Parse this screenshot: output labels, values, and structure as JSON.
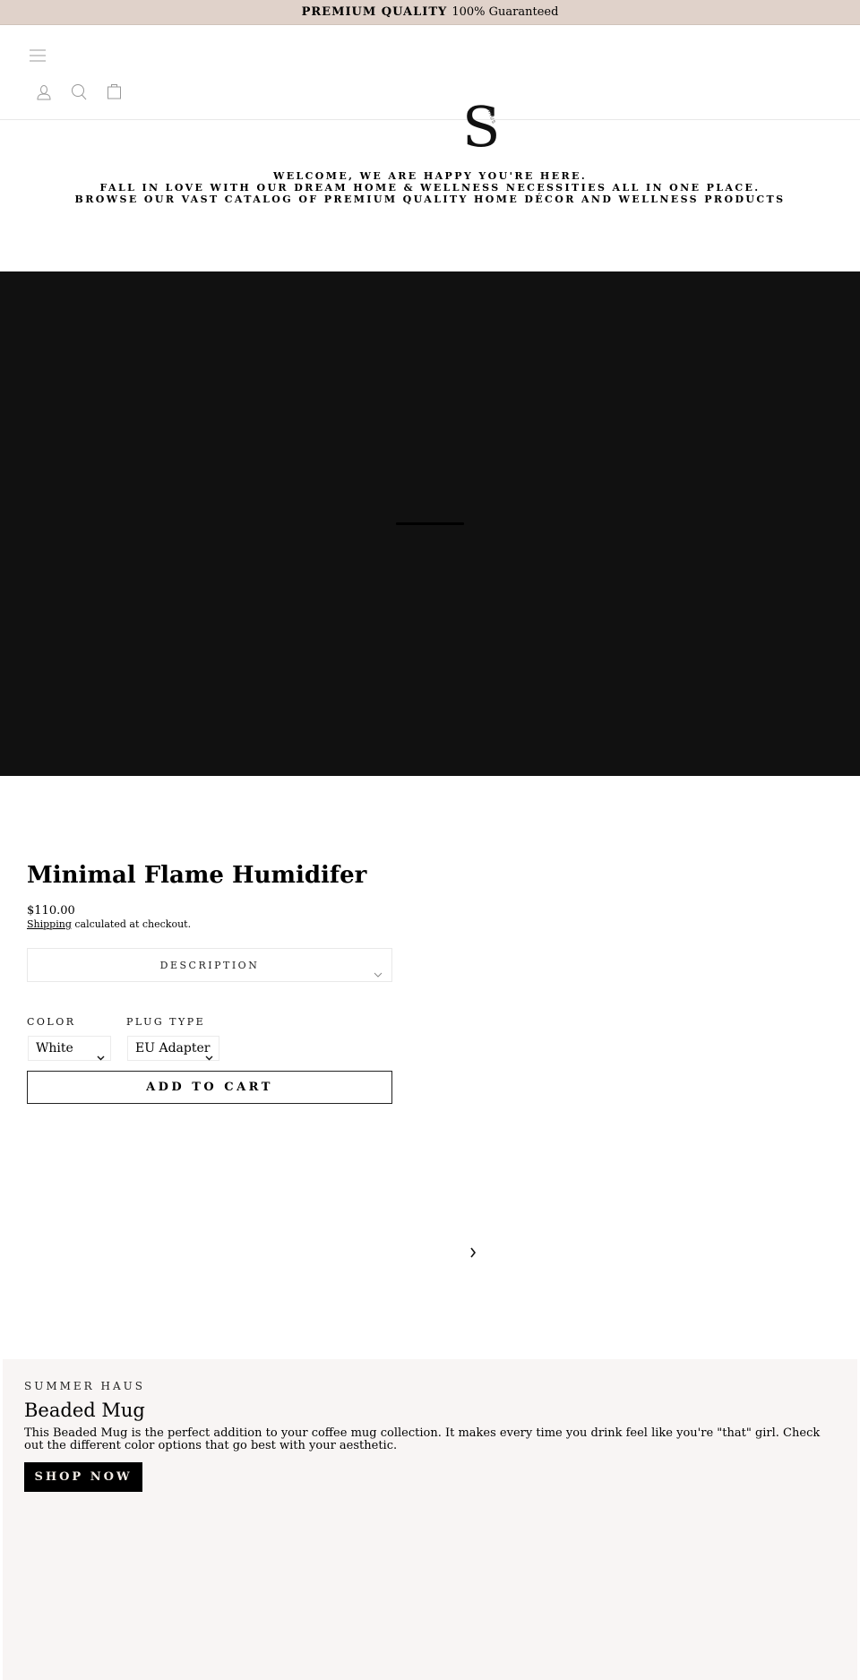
{
  "announcement": {
    "strong": "PREMIUM QUALITY",
    "text": "100% Guaranteed"
  },
  "header": {
    "icons": [
      "menu-icon",
      "account-icon",
      "search-icon",
      "cart-icon"
    ],
    "logo": {
      "letter": "S",
      "tag": "HAUS"
    }
  },
  "welcome": {
    "lines": [
      "WELCOME, WE ARE HAPPY YOU'RE HERE.",
      "FALL IN LOVE WITH OUR DREAM HOME & WELLNESS NECESSITIES ALL IN ONE PLACE.",
      "BROWSE OUR VAST CATALOG OF PREMIUM QUALITY HOME DÉCOR AND WELLNESS PRODUCTS"
    ]
  },
  "product": {
    "title": "Minimal Flame Humidifer",
    "price": "$110.00",
    "shipping_link": "Shipping",
    "shipping_text": " calculated at checkout.",
    "description_label": "DESCRIPTION",
    "options": [
      {
        "label": "COLOR",
        "value": "White"
      },
      {
        "label": "PLUG TYPE",
        "value": "EU Adapter"
      }
    ],
    "add_to_cart": "ADD TO CART"
  },
  "promo": {
    "subtitle": "SUMMER HAUS",
    "title": "Beaded Mug",
    "text": "This Beaded Mug is the perfect addition to your coffee mug collection. It makes every time you drink feel like you're \"that\" girl. Check out the different color options that go best with your aesthetic.",
    "button": "SHOP NOW"
  },
  "colors": {
    "announcement_bg": "#e0d2ca",
    "media_bg": "#111111",
    "promo_bg": "#f8f5f4",
    "button_bg": "#000000"
  }
}
